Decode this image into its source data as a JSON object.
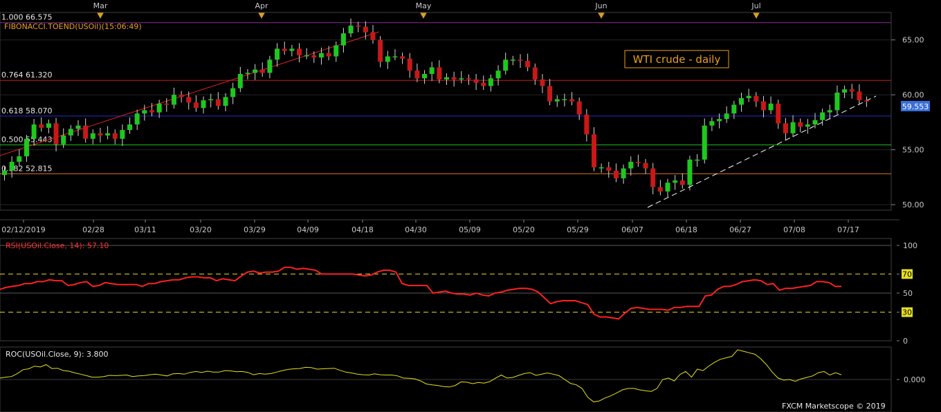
{
  "chart_data": [
    {
      "type": "candlestick",
      "title": "",
      "indicator_label": "FIBONACCI.TOEND(USOil)(15:06:49)",
      "annotation": "WTI crude - daily",
      "last_price": "59.553",
      "ylim": [
        49.5,
        67.5
      ],
      "yticks": [
        "65.00",
        "60.00",
        "55.00",
        "50.00"
      ],
      "month_labels": [
        "Mar",
        "Apr",
        "May",
        "Jun",
        "Jul"
      ],
      "date_labels": [
        "02/12/2019",
        "02/28",
        "03/11",
        "03/20",
        "03/29",
        "04/09",
        "04/18",
        "04/30",
        "05/09",
        "05/20",
        "05/29",
        "06/07",
        "06/18",
        "06/27",
        "07/08",
        "07/17"
      ],
      "fib_levels": [
        {
          "label": "1.000 66.575",
          "value": 66.575,
          "color": "#8a2a9a"
        },
        {
          "label": "0.764 61.320",
          "value": 61.32,
          "color": "#d01818"
        },
        {
          "label": "0.618 58.070",
          "value": 58.07,
          "color": "#2828d0"
        },
        {
          "label": "0.500 55.443",
          "value": 55.443,
          "color": "#20c020"
        },
        {
          "label": "0.382 52.815",
          "value": 52.815,
          "color": "#e07020"
        }
      ],
      "candles_close": [
        53.1,
        53.9,
        54.4,
        56.0,
        57.3,
        57.0,
        57.4,
        55.5,
        56.3,
        56.9,
        57.2,
        56.0,
        56.5,
        56.3,
        56.5,
        56.0,
        56.8,
        57.3,
        58.3,
        58.6,
        58.4,
        59.2,
        59.1,
        60.0,
        59.8,
        59.3,
        58.8,
        59.5,
        59.6,
        59.0,
        59.8,
        60.6,
        61.9,
        62.0,
        62.3,
        62.0,
        63.2,
        64.2,
        64.0,
        64.2,
        63.6,
        63.6,
        63.4,
        63.8,
        63.5,
        64.5,
        65.6,
        66.3,
        66.2,
        65.7,
        65.0,
        63.0,
        63.5,
        63.5,
        63.3,
        62.2,
        61.5,
        61.9,
        62.5,
        61.4,
        61.6,
        61.4,
        61.5,
        61.4,
        61.1,
        60.8,
        61.5,
        62.2,
        63.2,
        63.2,
        63.1,
        62.5,
        61.4,
        60.8,
        59.4,
        59.6,
        59.6,
        59.4,
        58.2,
        56.4,
        53.4,
        53.4,
        53.1,
        52.4,
        53.3,
        53.9,
        53.8,
        53.3,
        51.6,
        51.2,
        52.0,
        52.2,
        51.8,
        54.1,
        54.1,
        57.2,
        57.6,
        57.8,
        58.3,
        59.1,
        59.7,
        59.9,
        59.4,
        58.6,
        59.2,
        57.4,
        56.5,
        57.5,
        57.1,
        57.3,
        57.7,
        58.4,
        58.6,
        60.2,
        60.5,
        60.3,
        59.5,
        59.4
      ]
    },
    {
      "type": "line",
      "title": "",
      "indicator_label": "RSI(USOil.Close, 14): 57.10",
      "ylim": [
        0,
        100
      ],
      "yticks": [
        "100",
        "70",
        "50",
        "30",
        "0"
      ],
      "levels": [
        70,
        50,
        30
      ],
      "values": [
        54,
        56,
        57,
        58,
        60,
        60,
        62,
        62,
        64,
        63,
        63,
        58,
        59,
        61,
        62,
        57,
        58,
        61,
        60,
        59,
        59,
        59,
        59,
        57,
        60,
        60,
        62,
        63,
        64,
        64,
        66,
        67,
        67,
        66,
        66,
        63,
        65,
        64,
        63,
        68,
        72,
        73,
        71,
        72,
        72,
        73,
        77,
        77,
        75,
        76,
        75,
        74,
        70,
        70,
        70,
        70,
        70,
        70,
        69,
        68,
        69,
        72,
        74,
        74,
        72,
        60,
        58,
        58,
        58,
        58,
        50,
        51,
        52,
        50,
        49,
        49,
        48,
        50,
        48,
        47,
        50,
        51,
        53,
        54,
        55,
        55,
        54,
        51,
        45,
        39,
        41,
        42,
        42,
        42,
        40,
        38,
        28,
        25,
        25,
        24,
        23,
        29,
        34,
        35,
        34,
        33,
        33,
        33,
        32,
        35,
        35,
        36,
        36,
        36,
        47,
        48,
        54,
        57,
        57,
        59,
        62,
        63,
        64,
        63,
        59,
        60,
        53,
        55,
        55,
        56,
        57,
        58,
        62,
        62,
        61,
        57,
        57
      ]
    },
    {
      "type": "line",
      "title": "",
      "indicator_label": "ROC(USOil.Close, 9): 3.800",
      "ytick": "0.000",
      "values": [
        0.5,
        0.8,
        1.0,
        2.0,
        3.3,
        3.6,
        4.5,
        4.2,
        5.0,
        3.7,
        3.8,
        3.0,
        2.8,
        2.2,
        1.8,
        1.3,
        0.8,
        0.8,
        1.0,
        1.4,
        1.3,
        1.4,
        1.5,
        1.0,
        1.2,
        1.3,
        1.6,
        1.8,
        1.5,
        1.2,
        1.9,
        2.0,
        1.8,
        2.4,
        2.7,
        2.4,
        2.8,
        2.5,
        2.5,
        3.0,
        2.9,
        2.6,
        2.7,
        2.4,
        1.6,
        2.0,
        1.8,
        2.0,
        2.5,
        3.0,
        3.4,
        3.6,
        3.7,
        4.1,
        4.0,
        3.5,
        3.6,
        3.7,
        3.8,
        3.1,
        2.5,
        2.2,
        1.8,
        1.6,
        1.5,
        1.9,
        1.6,
        1.5,
        1.5,
        1.2,
        0.5,
        0.4,
        0.2,
        -0.5,
        -1.5,
        -1.8,
        -2.0,
        -2.4,
        -2.5,
        -2.0,
        -0.8,
        -0.9,
        -1.4,
        -1.0,
        -1.2,
        -0.7,
        0.5,
        1.5,
        0.5,
        0.7,
        1.4,
        2.0,
        2.3,
        1.4,
        1.8,
        2.2,
        1.8,
        1.3,
        0.0,
        -1.3,
        -1.8,
        -3.0,
        -6.0,
        -7.5,
        -7.2,
        -6.2,
        -5.5,
        -4.5,
        -3.5,
        -3.0,
        -3.0,
        -3.5,
        -3.8,
        -4.0,
        -3.0,
        0.0,
        0.5,
        -0.5,
        1.7,
        2.7,
        0.8,
        3.5,
        3.0,
        4.5,
        5.8,
        6.8,
        7.3,
        7.8,
        10.0,
        9.5,
        9.0,
        8.5,
        7.0,
        5.0,
        2.5,
        0.5,
        -0.2,
        0.0,
        -0.6,
        0.2,
        0.7,
        1.2,
        2.3,
        2.7,
        1.5,
        2.3,
        1.6
      ]
    }
  ],
  "footer": {
    "copyright": "FXCM Marketscope © 2019"
  }
}
